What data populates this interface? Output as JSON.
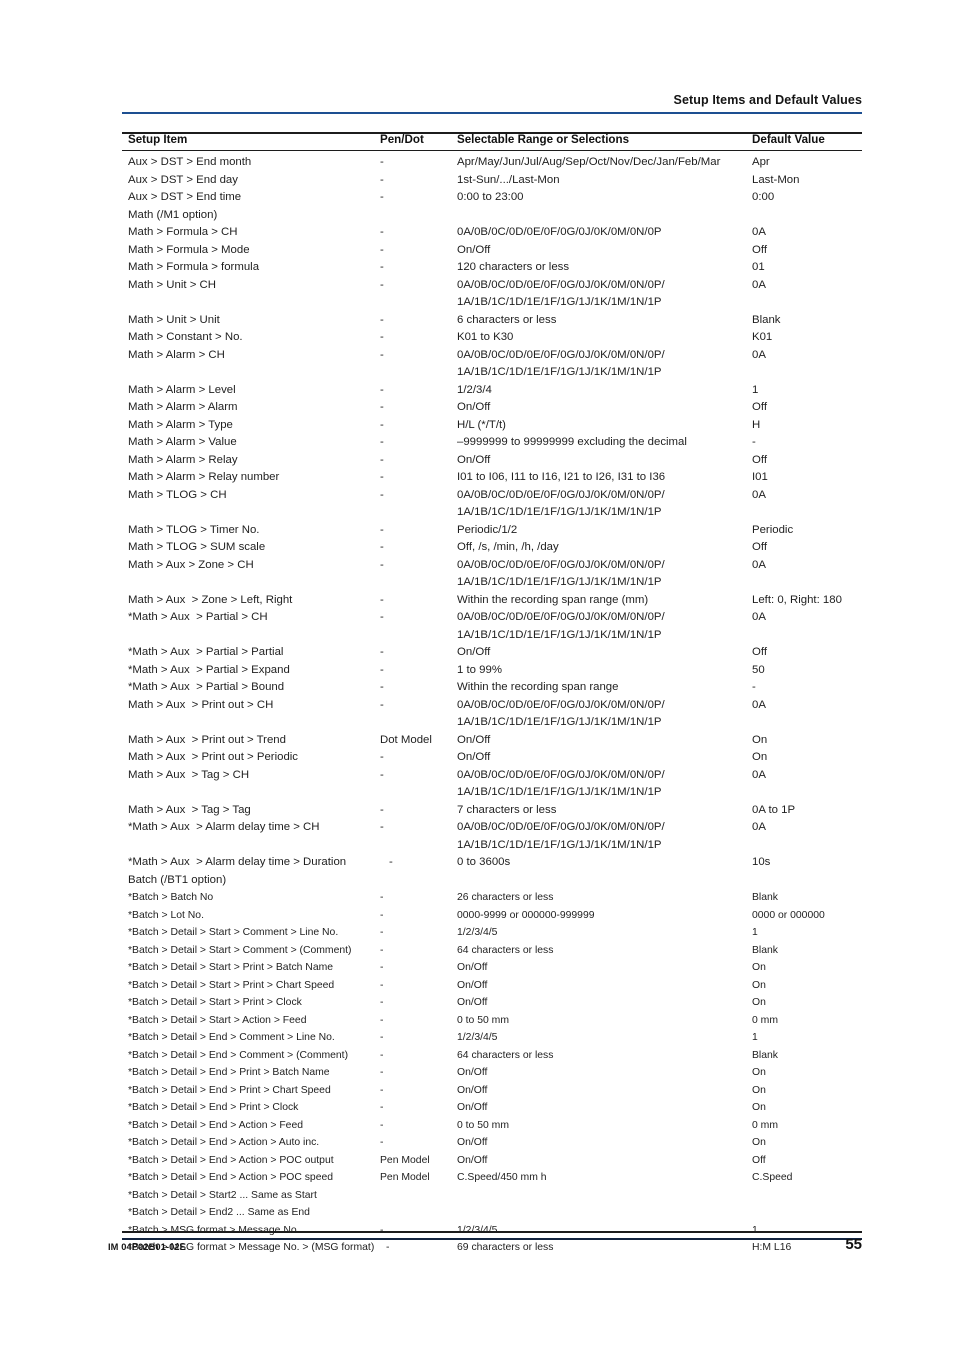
{
  "header": {
    "running_title": "Setup Items and Default Values",
    "rule_color": "#1d4f91"
  },
  "footer": {
    "document_number": "IM 04P02B01-02E",
    "page_number": "55"
  },
  "table": {
    "columns": [
      "Setup Item",
      "Pen/Dot",
      "Selectable Range or Selections",
      "Default Value"
    ],
    "channel_codes_line1": "0A/0B/0C/0D/0E/0F/0G/0J/0K/0M/0N/0P/",
    "channel_codes_line2": "1A/1B/1C/1D/1E/1F/1G/1J/1K/1M/1N/1P",
    "rows": [
      {
        "item": "Aux > DST > End month",
        "pen": "-",
        "range": "Apr/May/Jun/Jul/Aug/Sep/Oct/Nov/Dec/Jan/Feb/Mar",
        "def": "Apr",
        "size": "math"
      },
      {
        "item": "Aux > DST > End day",
        "pen": "-",
        "range": "1st-Sun/.../Last-Mon",
        "def": "Last-Mon",
        "size": "math"
      },
      {
        "item": "Aux > DST > End time",
        "pen": "-",
        "range": "0:00 to 23:00",
        "def": "0:00",
        "size": "math"
      },
      {
        "item": "Math (/M1 option)",
        "pen": "",
        "range": "",
        "def": "",
        "size": "math",
        "section": true
      },
      {
        "item": "Math > Formula > CH",
        "pen": "-",
        "range": "0A/0B/0C/0D/0E/0F/0G/0J/0K/0M/0N/0P",
        "def": "0A",
        "size": "math"
      },
      {
        "item": "Math > Formula > Mode",
        "pen": "-",
        "range": "On/Off",
        "def": "Off",
        "size": "math"
      },
      {
        "item": "Math > Formula > formula",
        "pen": "-",
        "range": "120 characters or less",
        "def": "01",
        "size": "math"
      },
      {
        "item": "Math > Unit > CH",
        "pen": "-",
        "range": "0A/0B/0C/0D/0E/0F/0G/0J/0K/0M/0N/0P/",
        "cont": "1A/1B/1C/1D/1E/1F/1G/1J/1K/1M/1N/1P",
        "def": "0A",
        "size": "math"
      },
      {
        "item": "Math > Unit > Unit",
        "pen": "-",
        "range": "6 characters or less",
        "def": "Blank",
        "size": "math"
      },
      {
        "item": "Math > Constant > No.",
        "pen": "-",
        "range": "K01 to K30",
        "def": "K01",
        "size": "math"
      },
      {
        "item": "Math > Alarm > CH",
        "pen": "-",
        "range": "0A/0B/0C/0D/0E/0F/0G/0J/0K/0M/0N/0P/",
        "cont": "1A/1B/1C/1D/1E/1F/1G/1J/1K/1M/1N/1P",
        "def": "0A",
        "size": "math"
      },
      {
        "item": "Math > Alarm > Level",
        "pen": "-",
        "range": "1/2/3/4",
        "def": "1",
        "size": "math"
      },
      {
        "item": "Math > Alarm > Alarm",
        "pen": "-",
        "range": "On/Off",
        "def": "Off",
        "size": "math"
      },
      {
        "item": "Math > Alarm > Type",
        "pen": "-",
        "range": "H/L (*/T/t)",
        "def": "H",
        "size": "math"
      },
      {
        "item": "Math > Alarm > Value",
        "pen": "-",
        "range": "–9999999 to 99999999 excluding the decimal",
        "def": "-",
        "size": "math"
      },
      {
        "item": "Math > Alarm > Relay",
        "pen": "-",
        "range": "On/Off",
        "def": "Off",
        "size": "math"
      },
      {
        "item": "Math > Alarm > Relay number",
        "pen": "-",
        "range": "I01 to I06, I11 to I16, I21 to I26, I31 to I36",
        "def": "I01",
        "size": "math"
      },
      {
        "item": "Math > TLOG > CH",
        "pen": "-",
        "range": "0A/0B/0C/0D/0E/0F/0G/0J/0K/0M/0N/0P/",
        "cont": "1A/1B/1C/1D/1E/1F/1G/1J/1K/1M/1N/1P",
        "def": "0A",
        "size": "math"
      },
      {
        "item": "Math > TLOG > Timer No.",
        "pen": "-",
        "range": "Periodic/1/2",
        "def": "Periodic",
        "size": "math"
      },
      {
        "item": "Math > TLOG > SUM scale",
        "pen": "-",
        "range": "Off, /s, /min, /h, /day",
        "def": "Off",
        "size": "math"
      },
      {
        "item": "Math > Aux > Zone > CH",
        "pen": "-",
        "range": "0A/0B/0C/0D/0E/0F/0G/0J/0K/0M/0N/0P/",
        "cont": "1A/1B/1C/1D/1E/1F/1G/1J/1K/1M/1N/1P",
        "def": "0A",
        "size": "math"
      },
      {
        "item": "Math > Aux  > Zone > Left, Right",
        "pen": "-",
        "range": "Within the recording span range (mm)",
        "def": "Left: 0, Right: 180",
        "size": "math"
      },
      {
        "item": "*Math > Aux  > Partial > CH",
        "pen": "-",
        "range": "0A/0B/0C/0D/0E/0F/0G/0J/0K/0M/0N/0P/",
        "cont": "1A/1B/1C/1D/1E/1F/1G/1J/1K/1M/1N/1P",
        "def": "0A",
        "size": "math"
      },
      {
        "item": "*Math > Aux  > Partial > Partial",
        "pen": "-",
        "range": "On/Off",
        "def": "Off",
        "size": "math"
      },
      {
        "item": "*Math > Aux  > Partial > Expand",
        "pen": "-",
        "range": "1 to 99%",
        "def": "50",
        "size": "math"
      },
      {
        "item": "*Math > Aux  > Partial > Bound",
        "pen": "-",
        "range": "Within the recording span range",
        "def": "-",
        "size": "math"
      },
      {
        "item": "Math > Aux  > Print out > CH",
        "pen": "-",
        "range": "0A/0B/0C/0D/0E/0F/0G/0J/0K/0M/0N/0P/",
        "cont": "1A/1B/1C/1D/1E/1F/1G/1J/1K/1M/1N/1P",
        "def": "0A",
        "size": "math"
      },
      {
        "item": "Math > Aux  > Print out > Trend",
        "pen": "Dot Model",
        "range": "On/Off",
        "def": "On",
        "size": "math"
      },
      {
        "item": "Math > Aux  > Print out > Periodic",
        "pen": "-",
        "range": "On/Off",
        "def": "On",
        "size": "math"
      },
      {
        "item": "Math > Aux  > Tag > CH",
        "pen": "-",
        "range": "0A/0B/0C/0D/0E/0F/0G/0J/0K/0M/0N/0P/",
        "cont": "1A/1B/1C/1D/1E/1F/1G/1J/1K/1M/1N/1P",
        "def": "0A",
        "size": "math"
      },
      {
        "item": "Math > Aux  > Tag > Tag",
        "pen": "-",
        "range": "7 characters or less",
        "def": "0A to 1P",
        "size": "math"
      },
      {
        "item": "*Math > Aux  > Alarm delay time > CH",
        "pen": "-",
        "range": "0A/0B/0C/0D/0E/0F/0G/0J/0K/0M/0N/0P/",
        "cont": "1A/1B/1C/1D/1E/1F/1G/1J/1K/1M/1N/1P",
        "def": "0A",
        "size": "math"
      },
      {
        "item": "*Math > Aux  > Alarm delay time > Duration",
        "pen": "-",
        "range": "0 to 3600s",
        "def": "10s",
        "size": "math",
        "pen_shift": 267
      },
      {
        "item": "Batch (/BT1 option)",
        "pen": "",
        "range": "",
        "def": "",
        "size": "math",
        "section": true
      },
      {
        "item": "*Batch > Batch No",
        "pen": "-",
        "range": "26 characters or less",
        "def": "Blank",
        "size": "batch"
      },
      {
        "item": "*Batch > Lot No.",
        "pen": "-",
        "range": "0000-9999 or 000000-999999",
        "def": "0000 or 000000",
        "size": "batch"
      },
      {
        "item": "*Batch > Detail > Start > Comment > Line No.",
        "pen": "-",
        "range": "1/2/3/4/5",
        "def": "1",
        "size": "batch"
      },
      {
        "item": "*Batch > Detail > Start > Comment > (Comment)",
        "pen": "-",
        "range": "64 characters or less",
        "def": "Blank",
        "size": "batch"
      },
      {
        "item": "*Batch > Detail > Start > Print > Batch Name",
        "pen": "-",
        "range": "On/Off",
        "def": "On",
        "size": "batch"
      },
      {
        "item": "*Batch > Detail > Start > Print > Chart Speed",
        "pen": "-",
        "range": "On/Off",
        "def": "On",
        "size": "batch"
      },
      {
        "item": "*Batch > Detail > Start > Print > Clock",
        "pen": "-",
        "range": "On/Off",
        "def": "On",
        "size": "batch"
      },
      {
        "item": "*Batch > Detail > Start > Action > Feed",
        "pen": "-",
        "range": "0 to 50 mm",
        "def": "0 mm",
        "size": "batch"
      },
      {
        "item": "*Batch > Detail > End > Comment > Line No.",
        "pen": "-",
        "range": "1/2/3/4/5",
        "def": "1",
        "size": "batch"
      },
      {
        "item": "*Batch > Detail > End > Comment > (Comment)",
        "pen": "-",
        "range": "64 characters or less",
        "def": "Blank",
        "size": "batch"
      },
      {
        "item": "*Batch > Detail > End > Print > Batch Name",
        "pen": "-",
        "range": "On/Off",
        "def": "On",
        "size": "batch"
      },
      {
        "item": "*Batch > Detail > End > Print > Chart Speed",
        "pen": "-",
        "range": "On/Off",
        "def": "On",
        "size": "batch"
      },
      {
        "item": "*Batch > Detail > End > Print > Clock",
        "pen": "-",
        "range": "On/Off",
        "def": "On",
        "size": "batch"
      },
      {
        "item": "*Batch > Detail > End > Action > Feed",
        "pen": "-",
        "range": "0 to 50 mm",
        "def": "0 mm",
        "size": "batch"
      },
      {
        "item": "*Batch > Detail > End > Action > Auto inc.",
        "pen": "-",
        "range": "On/Off",
        "def": "On",
        "size": "batch"
      },
      {
        "item": "*Batch > Detail > End > Action > POC output",
        "pen": "Pen Model",
        "range": "On/Off",
        "def": "Off",
        "size": "batch"
      },
      {
        "item": "*Batch > Detail > End > Action > POC speed",
        "pen": "Pen Model",
        "range": "C.Speed/450 mm h",
        "def": "C.Speed",
        "size": "batch"
      },
      {
        "item": "*Batch > Detail > Start2 ... Same as Start",
        "pen": "",
        "range": "",
        "def": "",
        "size": "batch"
      },
      {
        "item": "*Batch > Detail > End2 ... Same as End",
        "pen": "",
        "range": "",
        "def": "",
        "size": "batch"
      },
      {
        "item": "*Batch > MSG format > Message No.",
        "pen": "-",
        "range": "1/2/3/4/5",
        "def": "1",
        "size": "batch"
      },
      {
        "item": "*Batch > MSG format > Message No. > (MSG format)",
        "pen": "-",
        "range": "69 characters or less",
        "def": "H:M L16",
        "size": "batch",
        "pen_shift": 264
      }
    ]
  }
}
